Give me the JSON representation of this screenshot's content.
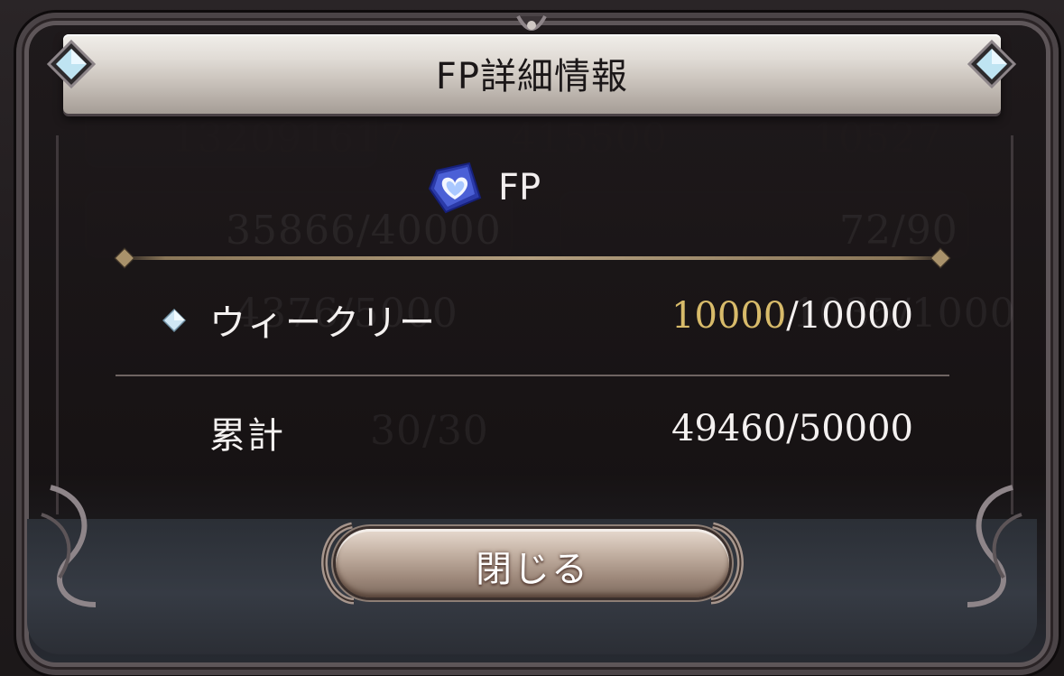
{
  "dialog": {
    "title": "FP詳細情報",
    "header_label": "FP",
    "header_icon": "blue-heart-crystal-icon"
  },
  "rows": [
    {
      "label": "ウィークリー",
      "current": "10000",
      "separator_max": "/10000",
      "icon": "diamond-icon"
    },
    {
      "label": "累計",
      "value": "49460/50000"
    }
  ],
  "close_button": {
    "label": "閉じる"
  },
  "background_ghost": {
    "values": [
      "132091617",
      "415500",
      "10527",
      "35866/40000",
      "72/90",
      "4376/5000",
      "1035/1000",
      "30/30"
    ]
  },
  "colors": {
    "highlight_value": "#d8bb6a",
    "text": "#f4f1f0",
    "ribbon": "#e1dcd6",
    "frame": "#4b4447"
  }
}
